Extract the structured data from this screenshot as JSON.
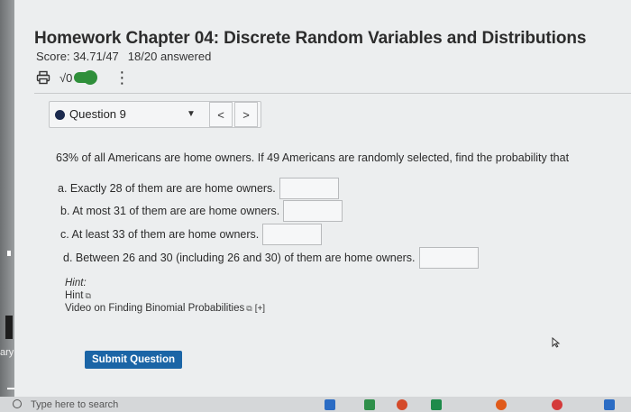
{
  "sidebar_fragment": {
    "text": "ary"
  },
  "header": {
    "title": "Homework Chapter 04: Discrete Random Variables and Distributions",
    "score": "Score: 34.71/47",
    "answered": "18/20 answered",
    "sqrt_symbol": "√0"
  },
  "question_nav": {
    "label": "Question 9",
    "prev": "<",
    "next": ">"
  },
  "question": {
    "text": "63% of all Americans are home owners. If 49 Americans are randomly selected, find the probability that",
    "parts": [
      {
        "label": "a. Exactly 28 of them are are home owners.",
        "value": ""
      },
      {
        "label": "b. At most 31 of them are are home owners.",
        "value": ""
      },
      {
        "label": "c. At least 33 of them are home owners.",
        "value": ""
      },
      {
        "label": "d. Between 26 and 30 (including 26 and 30) of them are home owners.",
        "value": ""
      }
    ]
  },
  "hints": {
    "title": "Hint:",
    "hint_link": "Hint",
    "video_link": "Video on Finding Binomial Probabilities",
    "expand": "[+]"
  },
  "submit": {
    "label": "Submit Question"
  },
  "taskbar": {
    "search_placeholder": "Type here to search"
  },
  "colors": {
    "accent": "#1b65a6",
    "toggle": "#2f8f3a",
    "dot": "#1b2a4e"
  }
}
